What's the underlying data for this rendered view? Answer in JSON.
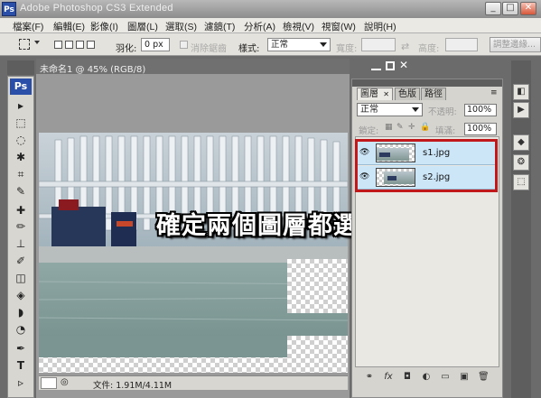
{
  "window": {
    "app_icon": "Ps",
    "title": "Adobe Photoshop CS3 Extended",
    "minimize_glyph": "_",
    "restore_glyph": "□",
    "close_glyph": "✕"
  },
  "menu": [
    "檔案(F)",
    "編輯(E)",
    "影像(I)",
    "圖層(L)",
    "選取(S)",
    "濾鏡(T)",
    "分析(A)",
    "檢視(V)",
    "視窗(W)",
    "說明(H)"
  ],
  "options": {
    "feather_label": "羽化:",
    "feather_value": "0 px",
    "antialias_label": "消除鋸齒",
    "style_label": "樣式:",
    "style_value": "正常",
    "width_label": "寬度:",
    "height_label": "高度:",
    "refine_edge_label": "調整邊緣..."
  },
  "toolbox": {
    "header": "Ps",
    "tools": [
      "move-tool",
      "marquee-tool",
      "lasso-tool",
      "magic-wand-tool",
      "crop-tool",
      "eyedropper-tool",
      "healing-brush-tool",
      "brush-tool",
      "clone-stamp-tool",
      "history-brush-tool",
      "eraser-tool",
      "paint-bucket-tool",
      "blur-tool",
      "dodge-tool",
      "pen-tool",
      "type-tool",
      "path-selection-tool"
    ],
    "tool_glyphs": [
      "▸",
      "⬚",
      "◌",
      "✱",
      "⌗",
      "✎",
      "✚",
      "✏",
      "⊥",
      "✐",
      "◫",
      "◈",
      "◗",
      "◔",
      "✒",
      "T",
      "▹"
    ]
  },
  "document": {
    "title": "未命名1 @ 45% (RGB/8)",
    "status": "文件: 1.91M/4.11M",
    "overlay_caption": "確定兩個圖層都選到了"
  },
  "layers_panel": {
    "tabs": [
      "圖層",
      "色版",
      "路徑"
    ],
    "active_tab": 0,
    "blend_mode": "正常",
    "opacity_label": "不透明:",
    "opacity_value": "100%",
    "lock_label": "鎖定:",
    "fill_label": "填滿:",
    "fill_value": "100%",
    "layers": [
      {
        "name": "s1.jpg",
        "visible": true,
        "selected": true
      },
      {
        "name": "s2.jpg",
        "visible": true,
        "selected": true
      }
    ],
    "highlight_color": "#c0181b",
    "bottom_icons": [
      "link-icon",
      "fx-icon",
      "mask-icon",
      "adjustment-icon",
      "group-icon",
      "new-layer-icon",
      "trash-icon"
    ],
    "bottom_glyphs": [
      "⚭",
      "fx",
      "◘",
      "◐",
      "▭",
      "▣",
      "🗑"
    ]
  },
  "colors": {
    "selection_highlight": "#cce6f8",
    "photoshop_blue": "#2a4fa8"
  }
}
